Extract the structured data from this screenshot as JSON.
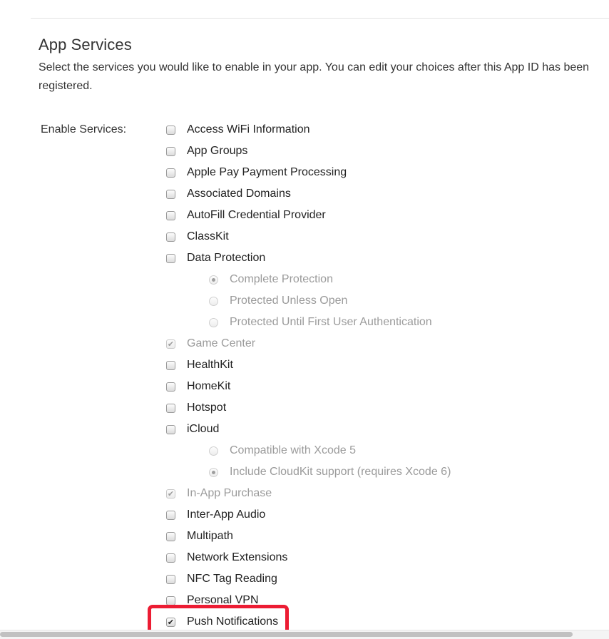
{
  "section": {
    "title": "App Services",
    "description": "Select the services you would like to enable in your app. You can edit your choices after this App ID has been registered.",
    "enable_label": "Enable Services:"
  },
  "services": [
    {
      "type": "checkbox",
      "label": "Access WiFi Information",
      "checked": false,
      "disabled": false
    },
    {
      "type": "checkbox",
      "label": "App Groups",
      "checked": false,
      "disabled": false
    },
    {
      "type": "checkbox",
      "label": "Apple Pay Payment Processing",
      "checked": false,
      "disabled": false
    },
    {
      "type": "checkbox",
      "label": "Associated Domains",
      "checked": false,
      "disabled": false
    },
    {
      "type": "checkbox",
      "label": "AutoFill Credential Provider",
      "checked": false,
      "disabled": false
    },
    {
      "type": "checkbox",
      "label": "ClassKit",
      "checked": false,
      "disabled": false
    },
    {
      "type": "checkbox",
      "label": "Data Protection",
      "checked": false,
      "disabled": false
    },
    {
      "type": "radio",
      "label": "Complete Protection",
      "checked": true,
      "disabled": true
    },
    {
      "type": "radio",
      "label": "Protected Unless Open",
      "checked": false,
      "disabled": true
    },
    {
      "type": "radio",
      "label": "Protected Until First User Authentication",
      "checked": false,
      "disabled": true
    },
    {
      "type": "checkbox",
      "label": "Game Center",
      "checked": true,
      "disabled": true
    },
    {
      "type": "checkbox",
      "label": "HealthKit",
      "checked": false,
      "disabled": false
    },
    {
      "type": "checkbox",
      "label": "HomeKit",
      "checked": false,
      "disabled": false
    },
    {
      "type": "checkbox",
      "label": "Hotspot",
      "checked": false,
      "disabled": false
    },
    {
      "type": "checkbox",
      "label": "iCloud",
      "checked": false,
      "disabled": false
    },
    {
      "type": "radio",
      "label": "Compatible with Xcode 5",
      "checked": false,
      "disabled": true
    },
    {
      "type": "radio",
      "label": "Include CloudKit support (requires Xcode 6)",
      "checked": true,
      "disabled": true
    },
    {
      "type": "checkbox",
      "label": "In-App Purchase",
      "checked": true,
      "disabled": true
    },
    {
      "type": "checkbox",
      "label": "Inter-App Audio",
      "checked": false,
      "disabled": false
    },
    {
      "type": "checkbox",
      "label": "Multipath",
      "checked": false,
      "disabled": false
    },
    {
      "type": "checkbox",
      "label": "Network Extensions",
      "checked": false,
      "disabled": false
    },
    {
      "type": "checkbox",
      "label": "NFC Tag Reading",
      "checked": false,
      "disabled": false
    },
    {
      "type": "checkbox",
      "label": "Personal VPN",
      "checked": false,
      "disabled": false
    },
    {
      "type": "checkbox",
      "label": "Push Notifications",
      "checked": true,
      "disabled": false
    }
  ],
  "colors": {
    "highlight": "#ec1c33",
    "text": "#333333",
    "disabled_text": "#9b9b9b"
  },
  "icons": {
    "checkmark": "check-icon",
    "radio_dot": "radio-dot-icon"
  }
}
